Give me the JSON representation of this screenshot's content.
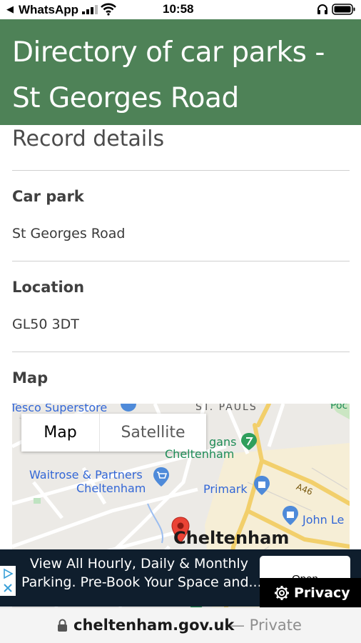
{
  "status_bar": {
    "back_glyph": "◀",
    "back_app": "WhatsApp",
    "time": "10:58",
    "icons": [
      "signal-icon",
      "wifi-icon",
      "headphones-icon",
      "battery-icon"
    ]
  },
  "header": {
    "title_line1": "Directory of car parks -",
    "title_line2": "St Georges Road",
    "background_color": "#4e8257"
  },
  "record": {
    "heading": "Record details",
    "fields": [
      {
        "label": "Car park",
        "value": "St Georges Road"
      },
      {
        "label": "Location",
        "value": "GL50 3DT"
      },
      {
        "label": "Map",
        "value": ""
      }
    ]
  },
  "map": {
    "toggle": {
      "map_label": "Map",
      "satellite_label": "Satellite",
      "selected": "Map"
    },
    "labels": {
      "tesco": "Tesco Superstore",
      "st_pauls": "ST. PAULS",
      "poc": "Poc",
      "debenhams_line1": "gans",
      "debenhams_line2": "Cheltenham",
      "waitrose_line1": "Waitrose & Partners",
      "waitrose_line2": "Cheltenham",
      "primark": "Primark",
      "a46": "A46",
      "john_lewis": "John Le",
      "town": "Cheltenham"
    }
  },
  "ad": {
    "line1": "View All Hourly, Daily & Monthly",
    "line2": "Parking. Pre-Book Your Space and...",
    "open_label": "Open",
    "privacy_label": "Privacy"
  },
  "address_bar": {
    "domain": "cheltenham.gov.uk",
    "mode": "— Private"
  }
}
